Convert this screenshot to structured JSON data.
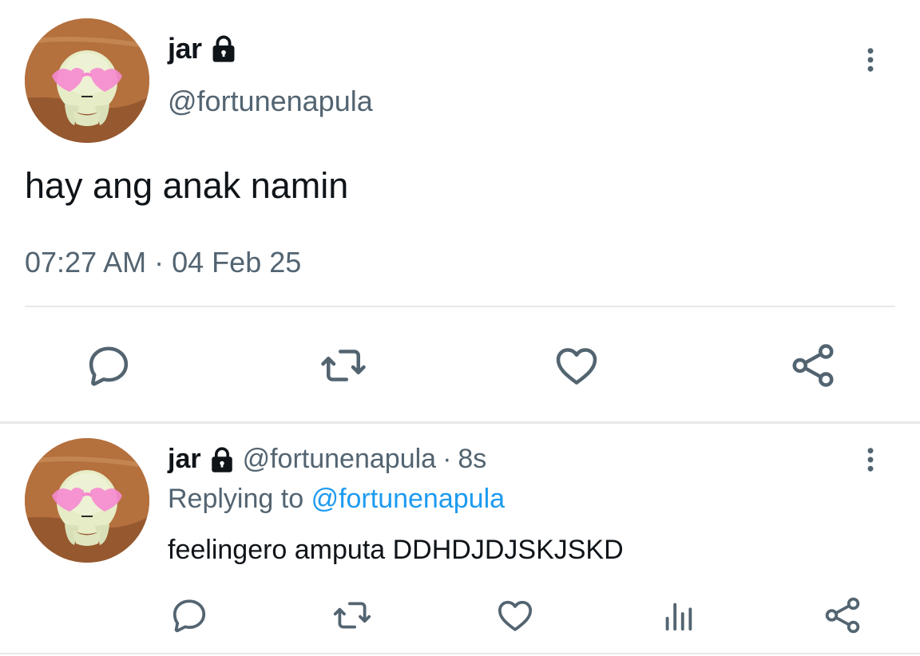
{
  "tweet": {
    "author_name": "jar",
    "handle": "@fortunenapula",
    "text": "hay ang anak namin",
    "timestamp": "07:27 AM",
    "separator": "·",
    "date": "04 Feb 25",
    "icons": {
      "lock": "lock-icon",
      "more": "more-vertical-icon",
      "reply": "reply-icon",
      "retweet": "retweet-icon",
      "like": "like-icon",
      "share": "share-icon"
    }
  },
  "reply": {
    "author_name": "jar",
    "handle": "@fortunenapula",
    "separator": "·",
    "age": "8s",
    "replying_prefix": "Replying to",
    "replying_to": "@fortunenapula",
    "text": "feelingero amputa DDHDJDJSKJSKD",
    "icons": {
      "lock": "lock-icon",
      "more": "more-vertical-icon",
      "reply": "reply-icon",
      "retweet": "retweet-icon",
      "like": "like-icon",
      "analytics": "analytics-icon",
      "share": "share-icon"
    }
  },
  "colors": {
    "primary_text": "#0f1419",
    "secondary_text": "#536471",
    "link": "#1d9bf0",
    "icon": "#536471",
    "divider": "#e6e8ea"
  }
}
